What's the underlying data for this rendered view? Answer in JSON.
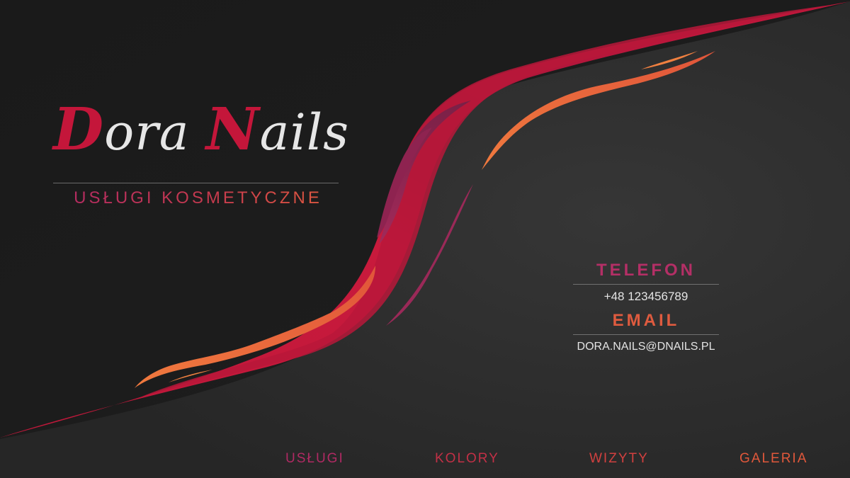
{
  "brand": {
    "title_initial_1": "D",
    "title_rest_1": "ora ",
    "title_initial_2": "N",
    "title_rest_2": "ails",
    "tagline": "USŁUGI KOSMETYCZNE"
  },
  "contact": {
    "phone_heading": "TELEFON",
    "phone_value": "+48 123456789",
    "email_heading": "EMAIL",
    "email_value": "DORA.NAILS@DNAILS.PL"
  },
  "nav": {
    "items": [
      {
        "label": "USŁUGI"
      },
      {
        "label": "KOLORY"
      },
      {
        "label": "WIZYTY"
      },
      {
        "label": "GALERIA"
      }
    ]
  },
  "colors": {
    "background": "#1d1d1d",
    "crimson": "#c4163a",
    "magenta": "#b12a63",
    "orange": "#e05b3e",
    "text_light": "#e6e6e6"
  }
}
